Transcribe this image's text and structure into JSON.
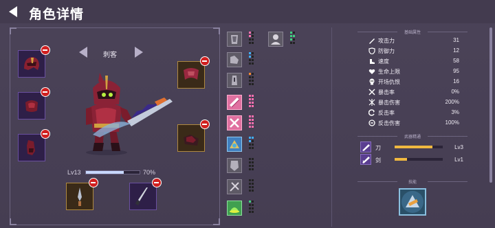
{
  "header": {
    "title": "角色详情"
  },
  "character": {
    "class_name": "刺客",
    "level_label": "Lv13",
    "level_progress": 0.7,
    "level_percent": "70%"
  },
  "stats": {
    "section_title": "基础属性",
    "items": [
      {
        "label": "攻击力",
        "value": "31",
        "icon": "sword-icon"
      },
      {
        "label": "防御力",
        "value": "12",
        "icon": "shield-icon"
      },
      {
        "label": "速度",
        "value": "58",
        "icon": "boot-icon"
      },
      {
        "label": "生命上限",
        "value": "95",
        "icon": "heart-icon"
      },
      {
        "label": "开场仇恨",
        "value": "16",
        "icon": "skull-icon"
      },
      {
        "label": "暴击率",
        "value": "0%",
        "icon": "crit-icon"
      },
      {
        "label": "暴击伤害",
        "value": "200%",
        "icon": "crit-damage-icon"
      },
      {
        "label": "反击率",
        "value": "3%",
        "icon": "counter-icon"
      },
      {
        "label": "反击伤害",
        "value": "100%",
        "icon": "counter-damage-icon"
      }
    ]
  },
  "weapons": {
    "section_title": "武器精通",
    "items": [
      {
        "label": "刀",
        "progress": 0.78,
        "level": "Lv3"
      },
      {
        "label": "剑",
        "progress": 0.25,
        "level": "Lv1"
      }
    ]
  },
  "ultimate": {
    "section_title": "技能"
  },
  "colors": {
    "accent": "#f0b840",
    "remove": "#d02020",
    "panel_bg": "#4b4358"
  }
}
